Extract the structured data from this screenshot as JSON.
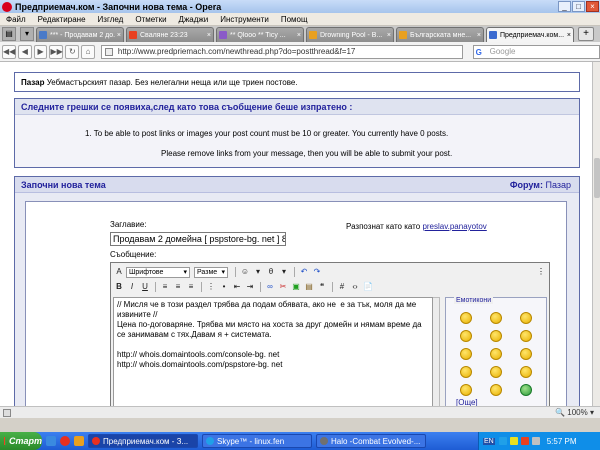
{
  "window": {
    "title": "Предприемач.ком - Започни нова тема - Opera"
  },
  "menu": [
    "Файл",
    "Редактиране",
    "Изглед",
    "Отметки",
    "Джаджи",
    "Инструменти",
    "Помощ"
  ],
  "tabs": [
    {
      "label": "*** - Продавам 2 до...",
      "color": "#4a7ac8",
      "active": false
    },
    {
      "label": "Сваляне 23:23",
      "color": "#e84020",
      "active": false
    },
    {
      "label": "** Qlooo ** Ticy ...",
      "color": "#8a5ac8",
      "active": false
    },
    {
      "label": "Drowning Pool - B...",
      "color": "#e8a020",
      "active": false
    },
    {
      "label": "Българската мне...",
      "color": "#e8a020",
      "active": false
    },
    {
      "label": "Предприемач.ком...",
      "color": "#3a6ad0",
      "active": true
    }
  ],
  "address": {
    "url": "http://www.predpriemach.com/newthread.php?do=postthread&f=17",
    "search_placeholder": "Google"
  },
  "market": {
    "label": "Пазар",
    "text": " Уебмастърският пазар. Без нелегални неща или ще триен постове."
  },
  "errors": {
    "header": "Следните грешки се появиха,след като това съобщение беше изпратено :",
    "item1": "1.  To be able to post links or images your post count must be 10 or greater. You currently have 0 posts.",
    "item2": "Please remove links from your message, then you will be able to submit your post."
  },
  "newthread": {
    "header": "Започни нова тема",
    "forum_label": "Форум:",
    "forum_value": "Пазар",
    "title_label": "Заглавие:",
    "title_value": "Продавам 2 домейна [ pspstore-bg. net ] 8",
    "logged_as_label": "Разпознат като като",
    "logged_as_user": "preslav.panayotov",
    "message_label": "Съобщение:"
  },
  "editor": {
    "font_select": "Шрифтове",
    "size_select": "Разме",
    "text": "// Мисля че в този раздел трябва да подам обявата, ако не  е за тък, моля да ме извините //\nЦена по-договаряне. Трябва ми място на хоста за друг домейн и нямам време да се занимавам с тях.Давам я + системата.\n\nhttp:// whois.domaintools.com/console-bg. net\nhttp:// whois.domaintools.com/pspstore-bg. net",
    "smilies_title": "Емотикони",
    "more_link": "[Още]"
  },
  "status": {
    "zoom": "100%"
  },
  "taskbar": {
    "start": "Старт",
    "tasks": [
      {
        "label": "Предприемач.ком - З...",
        "color": "#e83020",
        "active": true
      },
      {
        "label": "Skype™ - linux.fen",
        "color": "#20a0e8",
        "active": false
      },
      {
        "label": "Halo -Combat Evolved-...",
        "color": "#707070",
        "active": false
      }
    ],
    "lang": "EN",
    "clock": "5:57 PM"
  }
}
